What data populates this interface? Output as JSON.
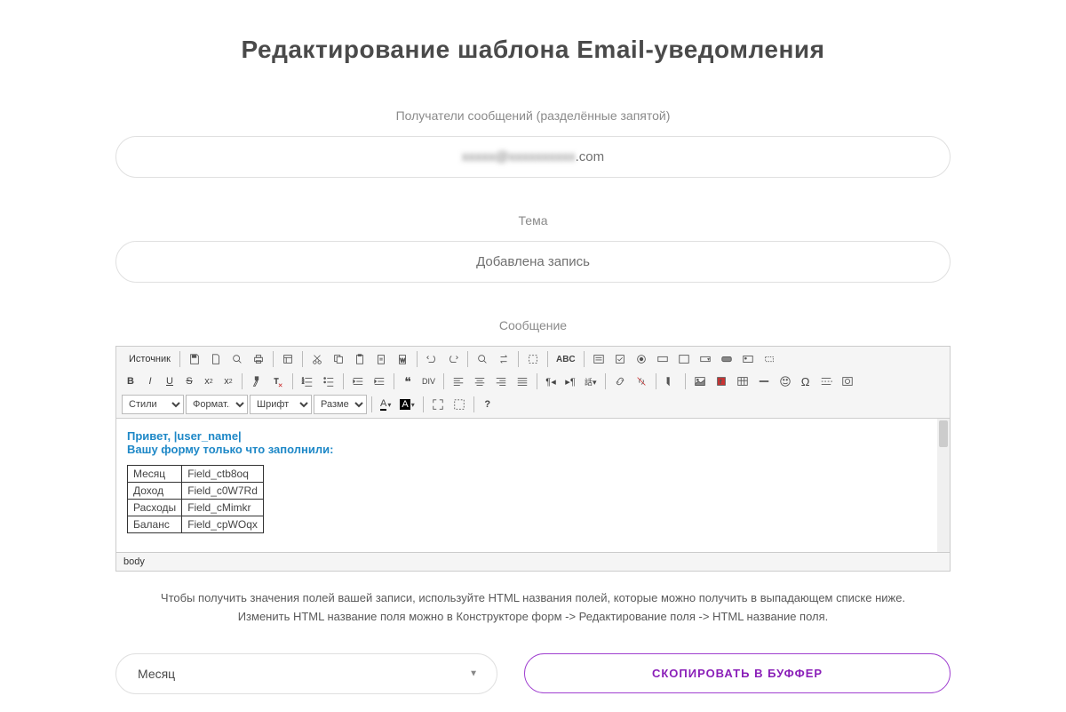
{
  "page_title": "Редактирование шаблона Email-уведомления",
  "recipients": {
    "label": "Получатели сообщений (разделённые запятой)",
    "value_blurred": "xxxxx@xxxxxxxxxx",
    "value_suffix": ".com"
  },
  "subject": {
    "label": "Тема",
    "value": "Добавлена запись"
  },
  "message": {
    "label": "Сообщение"
  },
  "toolbar": {
    "source": "Источник",
    "styles": "Стили",
    "format": "Формат...",
    "font": "Шрифт",
    "size": "Размер",
    "fontcolor_glyph": "A",
    "bgcolor_glyph": "A"
  },
  "editor": {
    "greeting": "Привет, |user_name|",
    "subheading": "Вашу форму только что заполнили:",
    "table": [
      {
        "k": "Месяц",
        "v": "Field_ctb8oq"
      },
      {
        "k": "Доход",
        "v": "Field_c0W7Rd"
      },
      {
        "k": "Расходы",
        "v": "Field_cMimkr"
      },
      {
        "k": "Баланс",
        "v": "Field_cpWOqx"
      }
    ],
    "status_path": "body"
  },
  "hint_line1": "Чтобы получить значения полей вашей записи, используйте HTML названия полей, которые можно получить в выпадающем списке ниже.",
  "hint_line2": "Изменить HTML название поля можно в Конструкторе форм -> Редактирование поля -> HTML название поля.",
  "field_select": {
    "value": "Месяц"
  },
  "copy_button": "СКОПИРОВАТЬ В БУФФЕР"
}
